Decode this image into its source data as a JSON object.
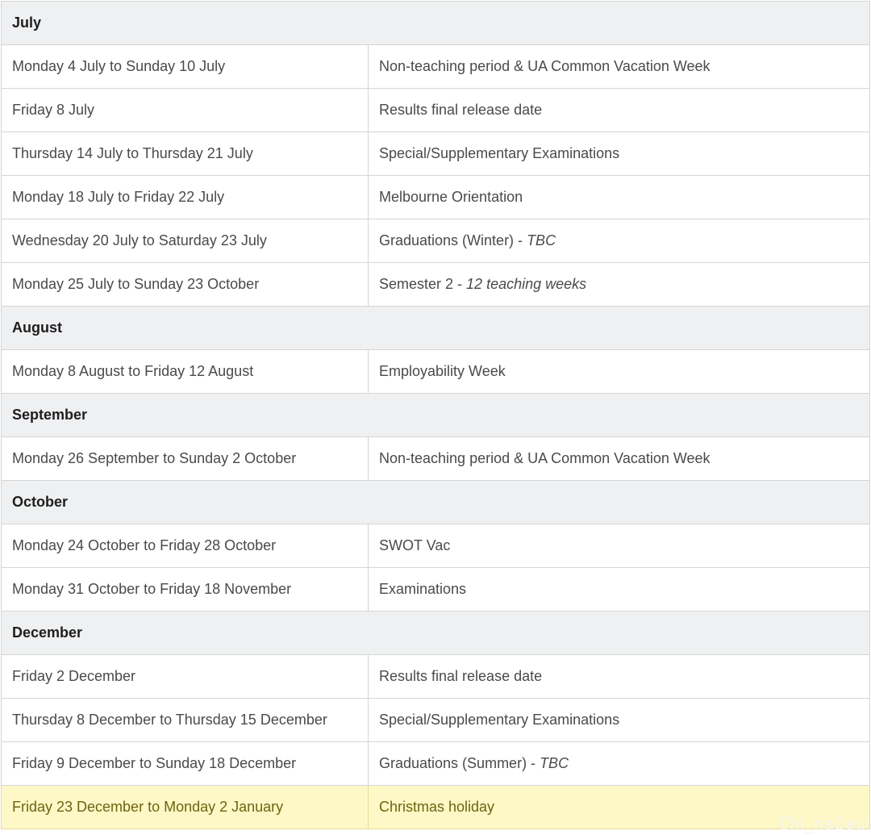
{
  "calendar": {
    "rows": [
      {
        "type": "month",
        "label": "July"
      },
      {
        "type": "event",
        "date": "Monday 4 July to Sunday 10 July",
        "event": "Non-teaching period & UA Common Vacation Week",
        "note": ""
      },
      {
        "type": "event",
        "date": "Friday 8 July",
        "event": "Results final release date",
        "note": ""
      },
      {
        "type": "event",
        "date": "Thursday 14 July to Thursday 21 July",
        "event": "Special/Supplementary Examinations",
        "note": ""
      },
      {
        "type": "event",
        "date": "Monday 18 July to Friday 22 July",
        "event": "Melbourne Orientation",
        "note": ""
      },
      {
        "type": "event",
        "date": "Wednesday 20 July to Saturday 23 July",
        "event": "Graduations (Winter) - ",
        "note": "TBC"
      },
      {
        "type": "event",
        "date": "Monday 25 July to Sunday 23 October",
        "event": "Semester 2 - ",
        "note": "12 teaching weeks"
      },
      {
        "type": "month",
        "label": "August"
      },
      {
        "type": "event",
        "date": "Monday 8 August to Friday 12 August",
        "event": "Employability Week",
        "note": ""
      },
      {
        "type": "month",
        "label": "September"
      },
      {
        "type": "event",
        "date": "Monday 26 September to Sunday 2 October",
        "event": "Non-teaching period & UA Common Vacation Week",
        "note": ""
      },
      {
        "type": "month",
        "label": "October"
      },
      {
        "type": "event",
        "date": "Monday 24 October to Friday 28 October",
        "event": "SWOT Vac",
        "note": ""
      },
      {
        "type": "event",
        "date": "Monday 31 October to Friday 18 November",
        "event": "Examinations",
        "note": ""
      },
      {
        "type": "month",
        "label": "December"
      },
      {
        "type": "event",
        "date": "Friday 2 December",
        "event": "Results final release date",
        "note": ""
      },
      {
        "type": "event",
        "date": "Thursday 8 December to Thursday 15 December",
        "event": "Special/Supplementary Examinations",
        "note": ""
      },
      {
        "type": "event",
        "date": "Friday 9 December to Sunday 18 December",
        "event": "Graduations (Summer) - ",
        "note": "TBC"
      },
      {
        "type": "event",
        "date": "Friday 23 December to Monday 2 January",
        "event": "Christmas holiday",
        "note": "",
        "highlight": true
      }
    ]
  },
  "watermark": "Chi_na2au",
  "colors": {
    "month_bg": "#eff0f2",
    "highlight_bg": "#fdf8c6",
    "highlight_text": "#6e6410",
    "border": "#d5d5d5"
  }
}
